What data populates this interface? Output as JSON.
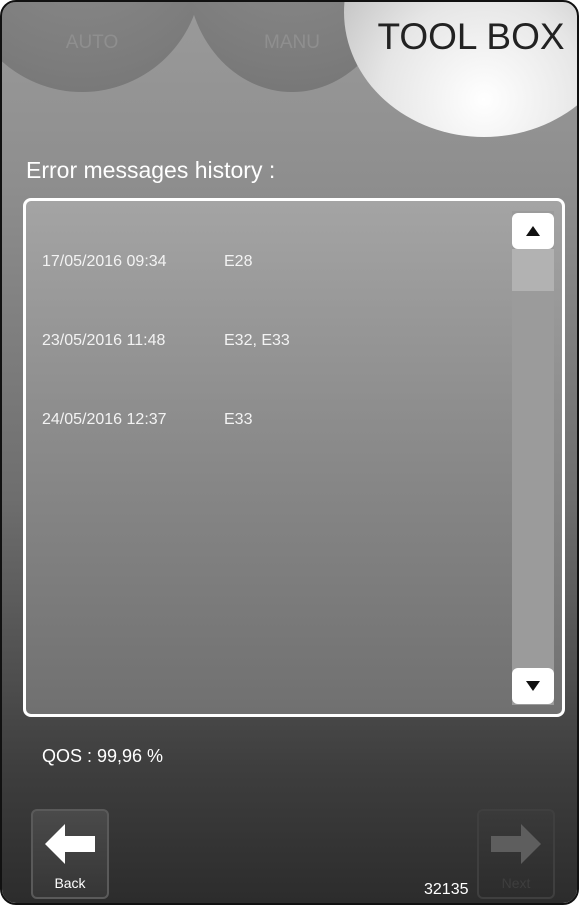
{
  "tabs": {
    "auto": "AUTO",
    "manu": "MANU",
    "toolbox": "TOOL BOX"
  },
  "section_title": "Error messages history :",
  "error_history": [
    {
      "date": "17/05/2016 09:34",
      "codes": "E28"
    },
    {
      "date": "23/05/2016 11:48",
      "codes": "E32, E33"
    },
    {
      "date": "24/05/2016 12:37",
      "codes": "E33"
    }
  ],
  "qos": "QOS : 99,96 %",
  "buttons": {
    "back": "Back",
    "next": "Next"
  },
  "reference_number": "32135",
  "icons": {
    "scroll_up": "arrow-up-icon",
    "scroll_down": "arrow-down-icon",
    "back": "arrow-left-icon",
    "next": "arrow-right-icon"
  }
}
